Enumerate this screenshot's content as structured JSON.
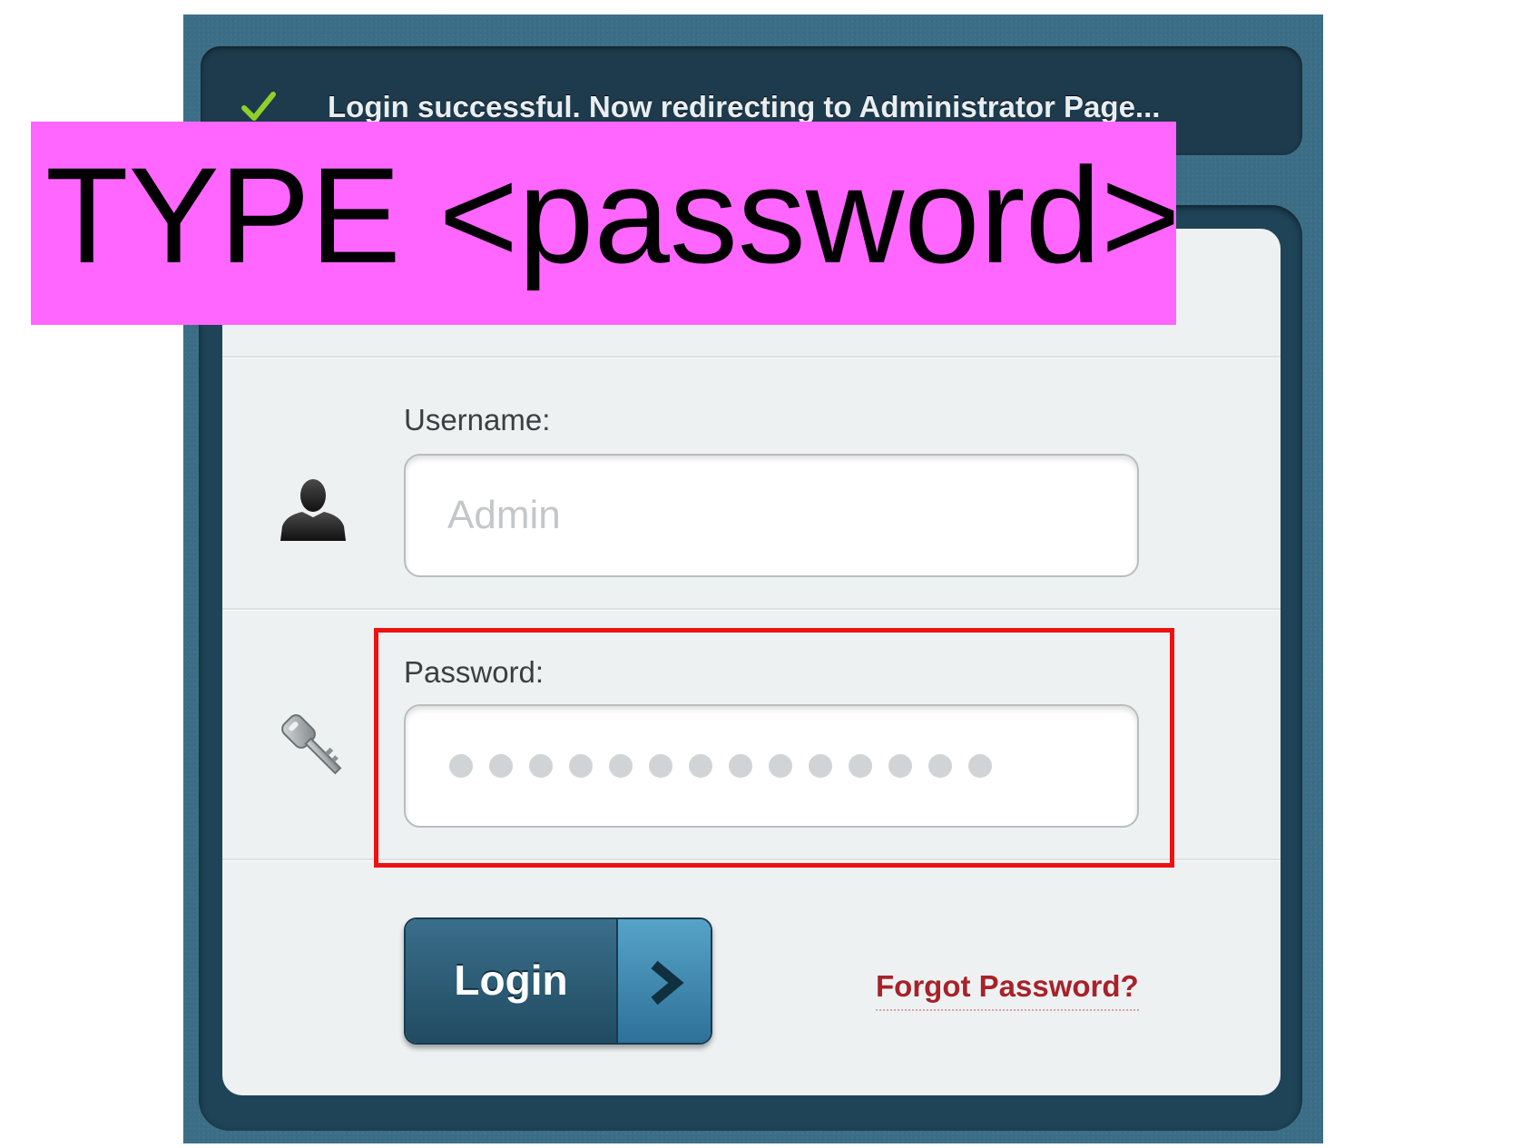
{
  "notification": {
    "icon": "check-icon",
    "message": "Login successful. Now redirecting to Administrator Page..."
  },
  "instruction": {
    "text": "TYPE <password>"
  },
  "form": {
    "username": {
      "label": "Username:",
      "placeholder": "Admin",
      "icon": "user-icon"
    },
    "password": {
      "label": "Password:",
      "masked_length": 14,
      "icon": "key-icon"
    },
    "login_button": {
      "label": "Login",
      "icon": "chevron-right-icon"
    },
    "forgot_link": "Forgot Password?"
  },
  "colors": {
    "instruction_background": "#ff66ff",
    "highlight_border": "#ee1111",
    "page_background": "#3b6e86",
    "link": "#a7222a"
  }
}
